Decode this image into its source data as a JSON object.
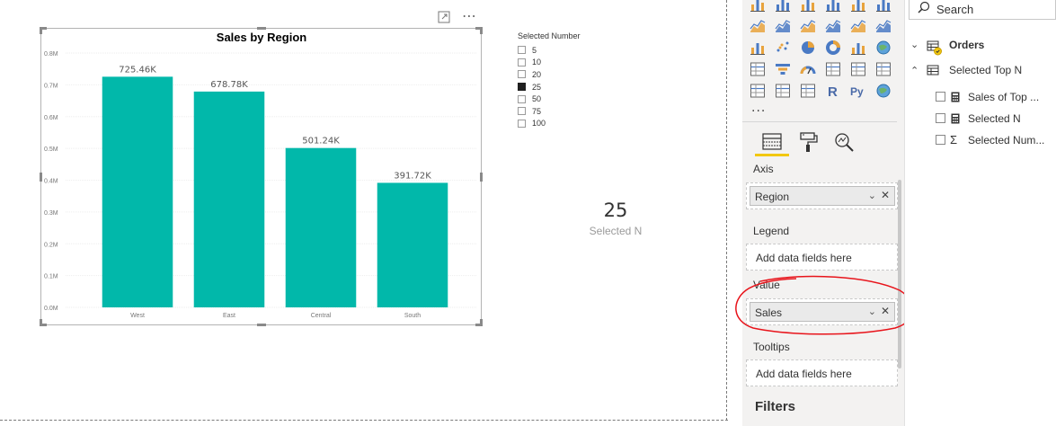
{
  "chart_data": {
    "type": "bar",
    "title": "Sales by Region",
    "categories": [
      "West",
      "East",
      "Central",
      "South"
    ],
    "values": [
      725460,
      678780,
      501240,
      391720
    ],
    "data_labels": [
      "725.46K",
      "678.78K",
      "501.24K",
      "391.72K"
    ],
    "y_ticks": [
      "0.0M",
      "0.1M",
      "0.2M",
      "0.3M",
      "0.4M",
      "0.5M",
      "0.6M",
      "0.7M",
      "0.8M"
    ],
    "ylim": [
      0,
      800000
    ],
    "grid": true,
    "bar_color": "#01b8aa"
  },
  "slicer": {
    "title": "Selected Number",
    "items": [
      {
        "label": "5",
        "checked": false
      },
      {
        "label": "10",
        "checked": false
      },
      {
        "label": "20",
        "checked": false
      },
      {
        "label": "25",
        "checked": true
      },
      {
        "label": "50",
        "checked": false
      },
      {
        "label": "75",
        "checked": false
      },
      {
        "label": "100",
        "checked": false
      }
    ]
  },
  "card": {
    "value": "25",
    "label": "Selected N"
  },
  "visual_header": {
    "focus_icon": "focus-mode-icon",
    "more_icon": "more-options-icon",
    "more_glyph": "⋯"
  },
  "visualizations_pane": {
    "more_label": "...",
    "tabs": [
      "fields-icon",
      "format-paint-roller-icon",
      "analytics-magnifier-icon"
    ],
    "wells": {
      "axis": {
        "label": "Axis",
        "field": "Region"
      },
      "legend": {
        "label": "Legend",
        "placeholder": "Add data fields here"
      },
      "value": {
        "label": "Value",
        "field": "Sales"
      },
      "tooltips": {
        "label": "Tooltips",
        "placeholder": "Add data fields here"
      }
    },
    "filters_label": "Filters",
    "accent_color": "#f2c811"
  },
  "fields_pane": {
    "search_placeholder": "Search",
    "tables": [
      {
        "name": "Orders",
        "expanded": false
      },
      {
        "name": "Selected Top N",
        "expanded": true,
        "fields": [
          {
            "name": "Sales of Top ...",
            "type": "measure"
          },
          {
            "name": "Selected N",
            "type": "measure"
          },
          {
            "name": "Selected Num...",
            "type": "sum"
          }
        ]
      }
    ]
  },
  "annotation_color": "#e8141b"
}
